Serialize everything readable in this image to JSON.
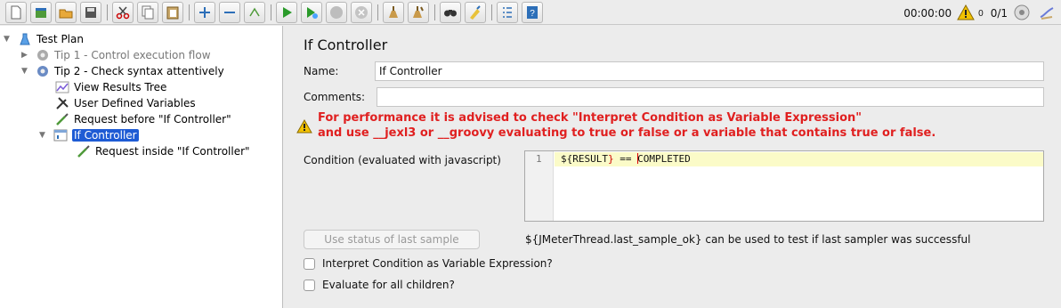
{
  "toolbar": {
    "timer": "00:00:00",
    "warning_count": "0",
    "thread_count": "0/1"
  },
  "tree": {
    "nodes": [
      {
        "label": "Test Plan",
        "icon": "test-plan-icon",
        "expander": "▼"
      },
      {
        "label": "Tip 1 - Control execution flow",
        "icon": "thread-group-icon",
        "expander": "▶",
        "disabled": true
      },
      {
        "label": "Tip 2 - Check syntax attentively",
        "icon": "thread-group-icon",
        "expander": "▼"
      },
      {
        "label": "View Results Tree",
        "icon": "results-tree-icon"
      },
      {
        "label": "User Defined Variables",
        "icon": "variables-icon"
      },
      {
        "label": "Request before \"If Controller\"",
        "icon": "sampler-icon"
      },
      {
        "label": "If Controller",
        "icon": "if-controller-icon",
        "expander": "▼",
        "selected": true
      },
      {
        "label": "Request inside \"If Controller\"",
        "icon": "sampler-icon"
      }
    ]
  },
  "panel": {
    "title": "If Controller",
    "name_label": "Name:",
    "name_value": "If Controller",
    "comments_label": "Comments:",
    "comments_value": "",
    "warning_line1": "For performance it is advised to check \"Interpret Condition as Variable Expression\"",
    "warning_line2": "and use __jexl3 or __groovy evaluating to true or false or a variable that contains true or false.",
    "condition_label": "Condition (evaluated with javascript)",
    "editor": {
      "line_number": "1",
      "code_prefix": "${",
      "code_var": "RESULT",
      "code_brace_close": "}",
      "code_mid": " == ",
      "code_value": "COMPLETED"
    },
    "use_status_button": "Use status of last sample",
    "hint": "${JMeterThread.last_sample_ok} can be used to test if last sampler was successful",
    "checkbox_interpret": "Interpret Condition as Variable Expression?",
    "checkbox_evaluate": "Evaluate for all children?"
  },
  "colors": {
    "selection": "#1e5bd4",
    "warning_text": "#e02020",
    "current_line": "#fbfbc8"
  }
}
